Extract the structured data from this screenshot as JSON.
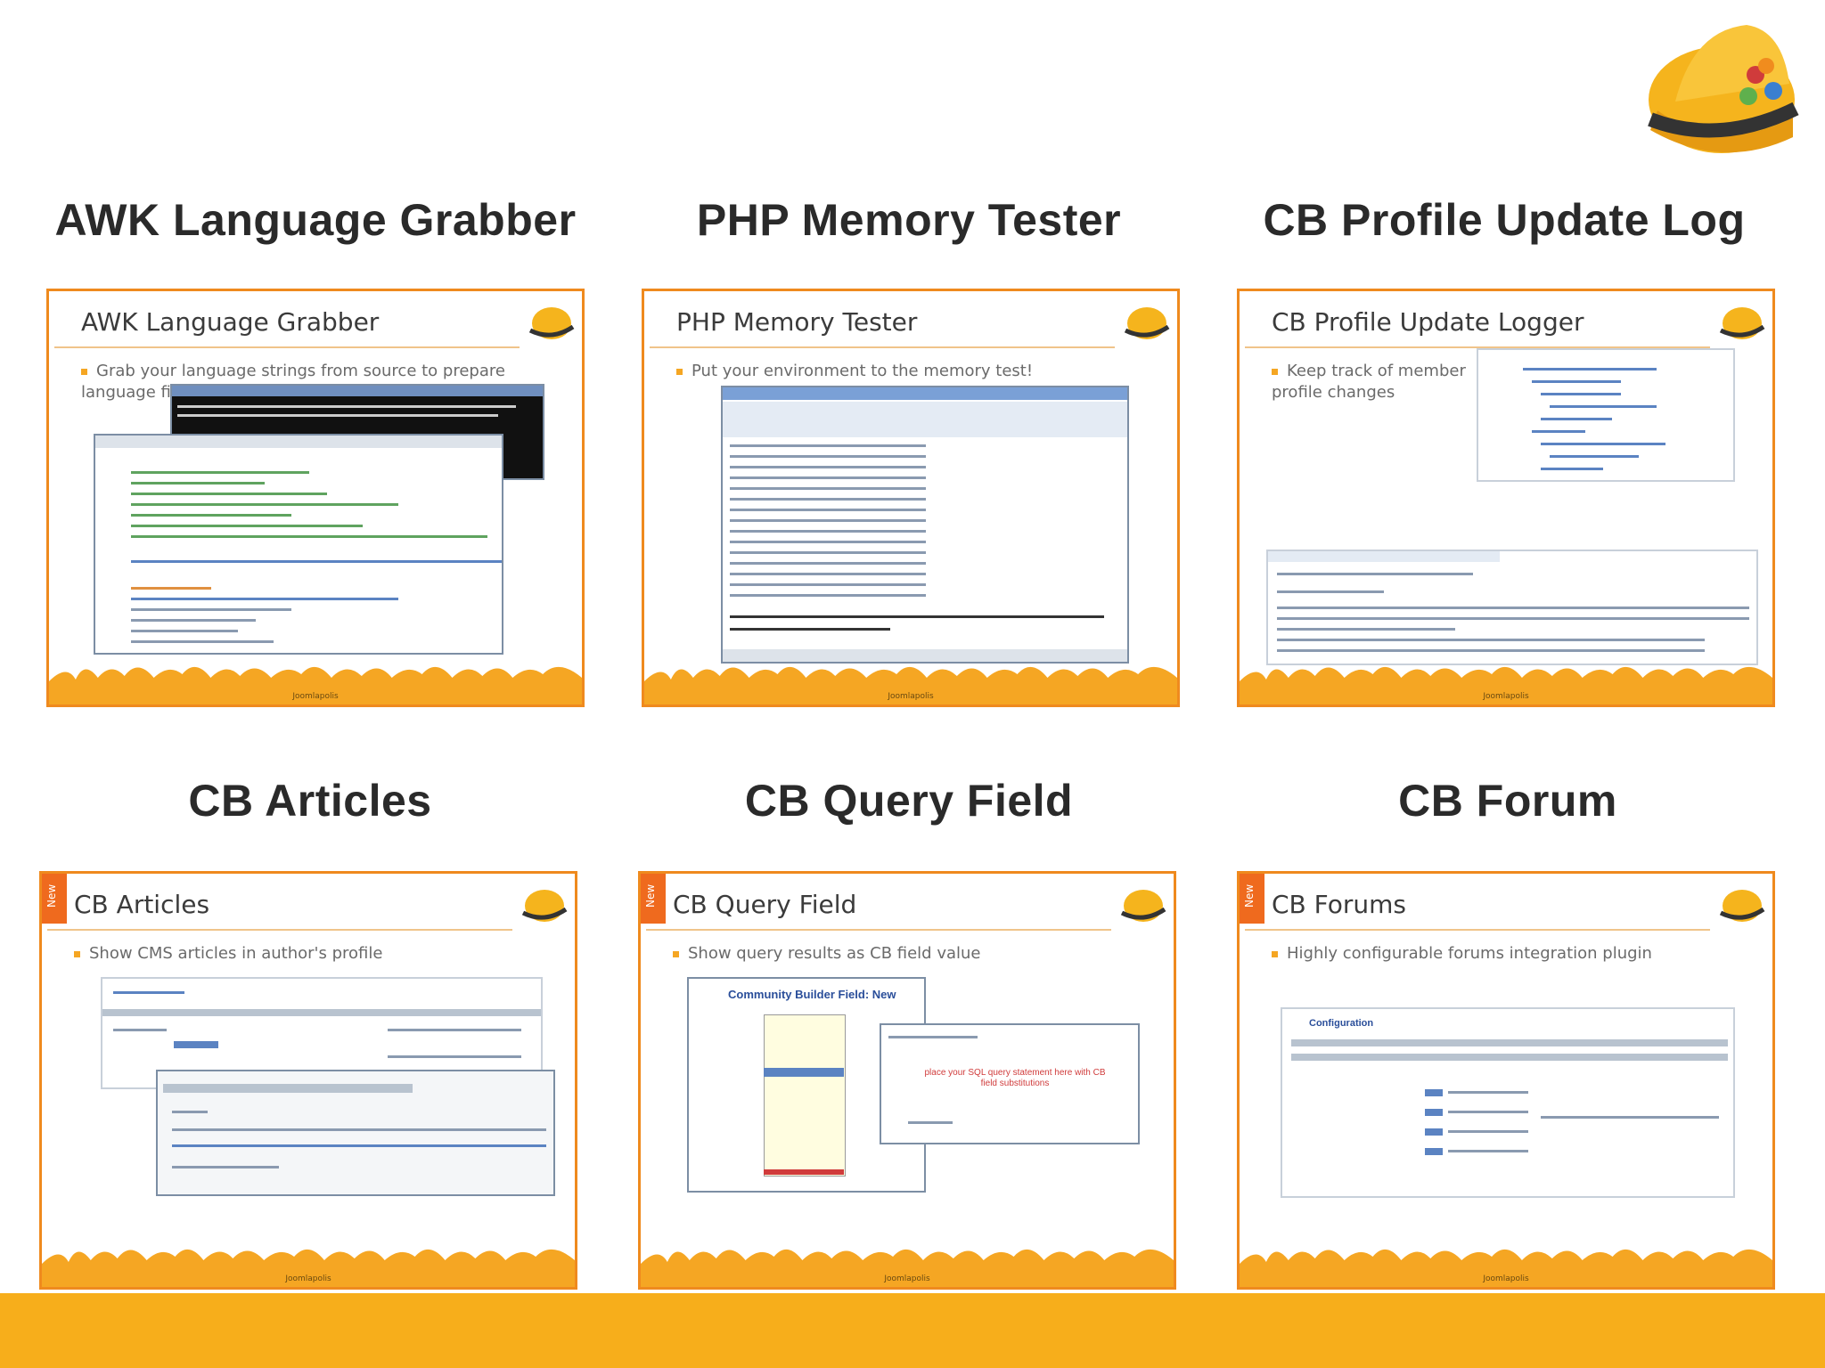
{
  "headings": {
    "h1": "AWK Language Grabber",
    "h2": "PHP Memory Tester",
    "h3": "CB Profile Update Log",
    "h4": "CB Articles",
    "h5": "CB Query Field",
    "h6": "CB Forum"
  },
  "slides": {
    "s1": {
      "title": "AWK Language Grabber",
      "bullet": "Grab your language strings from source to prepare language file"
    },
    "s2": {
      "title": "PHP Memory Tester",
      "bullet": "Put your environment to the memory test!"
    },
    "s3": {
      "title": "CB Profile Update Logger",
      "bullet": "Keep track of member profile changes"
    },
    "s4": {
      "title": "CB Articles",
      "bullet": "Show CMS articles in author's profile",
      "tab": "New"
    },
    "s5": {
      "title": "CB Query Field",
      "bullet": "Show query results as CB field value",
      "tab": "New",
      "shot_title": "Community Builder Field: New",
      "shot_msg": "place your SQL query statement here with CB field substitutions"
    },
    "s6": {
      "title": "CB Forums",
      "bullet": "Highly configurable forums integration plugin",
      "tab": "New",
      "shot_title": "Configuration"
    }
  },
  "footer": "Joomlapolis",
  "colors": {
    "accent": "#ef8a1e",
    "bar": "#f7ae1b",
    "helmet": "#f5b41d"
  }
}
